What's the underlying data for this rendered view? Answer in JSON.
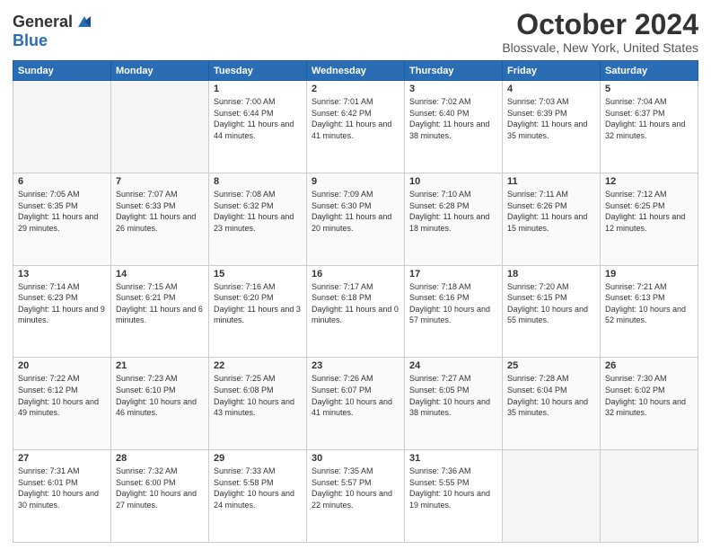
{
  "logo": {
    "general": "General",
    "blue": "Blue"
  },
  "header": {
    "month": "October 2024",
    "location": "Blossvale, New York, United States"
  },
  "weekdays": [
    "Sunday",
    "Monday",
    "Tuesday",
    "Wednesday",
    "Thursday",
    "Friday",
    "Saturday"
  ],
  "weeks": [
    [
      {
        "day": "",
        "empty": true
      },
      {
        "day": "",
        "empty": true
      },
      {
        "day": "1",
        "sunrise": "Sunrise: 7:00 AM",
        "sunset": "Sunset: 6:44 PM",
        "daylight": "Daylight: 11 hours and 44 minutes."
      },
      {
        "day": "2",
        "sunrise": "Sunrise: 7:01 AM",
        "sunset": "Sunset: 6:42 PM",
        "daylight": "Daylight: 11 hours and 41 minutes."
      },
      {
        "day": "3",
        "sunrise": "Sunrise: 7:02 AM",
        "sunset": "Sunset: 6:40 PM",
        "daylight": "Daylight: 11 hours and 38 minutes."
      },
      {
        "day": "4",
        "sunrise": "Sunrise: 7:03 AM",
        "sunset": "Sunset: 6:39 PM",
        "daylight": "Daylight: 11 hours and 35 minutes."
      },
      {
        "day": "5",
        "sunrise": "Sunrise: 7:04 AM",
        "sunset": "Sunset: 6:37 PM",
        "daylight": "Daylight: 11 hours and 32 minutes."
      }
    ],
    [
      {
        "day": "6",
        "sunrise": "Sunrise: 7:05 AM",
        "sunset": "Sunset: 6:35 PM",
        "daylight": "Daylight: 11 hours and 29 minutes."
      },
      {
        "day": "7",
        "sunrise": "Sunrise: 7:07 AM",
        "sunset": "Sunset: 6:33 PM",
        "daylight": "Daylight: 11 hours and 26 minutes."
      },
      {
        "day": "8",
        "sunrise": "Sunrise: 7:08 AM",
        "sunset": "Sunset: 6:32 PM",
        "daylight": "Daylight: 11 hours and 23 minutes."
      },
      {
        "day": "9",
        "sunrise": "Sunrise: 7:09 AM",
        "sunset": "Sunset: 6:30 PM",
        "daylight": "Daylight: 11 hours and 20 minutes."
      },
      {
        "day": "10",
        "sunrise": "Sunrise: 7:10 AM",
        "sunset": "Sunset: 6:28 PM",
        "daylight": "Daylight: 11 hours and 18 minutes."
      },
      {
        "day": "11",
        "sunrise": "Sunrise: 7:11 AM",
        "sunset": "Sunset: 6:26 PM",
        "daylight": "Daylight: 11 hours and 15 minutes."
      },
      {
        "day": "12",
        "sunrise": "Sunrise: 7:12 AM",
        "sunset": "Sunset: 6:25 PM",
        "daylight": "Daylight: 11 hours and 12 minutes."
      }
    ],
    [
      {
        "day": "13",
        "sunrise": "Sunrise: 7:14 AM",
        "sunset": "Sunset: 6:23 PM",
        "daylight": "Daylight: 11 hours and 9 minutes."
      },
      {
        "day": "14",
        "sunrise": "Sunrise: 7:15 AM",
        "sunset": "Sunset: 6:21 PM",
        "daylight": "Daylight: 11 hours and 6 minutes."
      },
      {
        "day": "15",
        "sunrise": "Sunrise: 7:16 AM",
        "sunset": "Sunset: 6:20 PM",
        "daylight": "Daylight: 11 hours and 3 minutes."
      },
      {
        "day": "16",
        "sunrise": "Sunrise: 7:17 AM",
        "sunset": "Sunset: 6:18 PM",
        "daylight": "Daylight: 11 hours and 0 minutes."
      },
      {
        "day": "17",
        "sunrise": "Sunrise: 7:18 AM",
        "sunset": "Sunset: 6:16 PM",
        "daylight": "Daylight: 10 hours and 57 minutes."
      },
      {
        "day": "18",
        "sunrise": "Sunrise: 7:20 AM",
        "sunset": "Sunset: 6:15 PM",
        "daylight": "Daylight: 10 hours and 55 minutes."
      },
      {
        "day": "19",
        "sunrise": "Sunrise: 7:21 AM",
        "sunset": "Sunset: 6:13 PM",
        "daylight": "Daylight: 10 hours and 52 minutes."
      }
    ],
    [
      {
        "day": "20",
        "sunrise": "Sunrise: 7:22 AM",
        "sunset": "Sunset: 6:12 PM",
        "daylight": "Daylight: 10 hours and 49 minutes."
      },
      {
        "day": "21",
        "sunrise": "Sunrise: 7:23 AM",
        "sunset": "Sunset: 6:10 PM",
        "daylight": "Daylight: 10 hours and 46 minutes."
      },
      {
        "day": "22",
        "sunrise": "Sunrise: 7:25 AM",
        "sunset": "Sunset: 6:08 PM",
        "daylight": "Daylight: 10 hours and 43 minutes."
      },
      {
        "day": "23",
        "sunrise": "Sunrise: 7:26 AM",
        "sunset": "Sunset: 6:07 PM",
        "daylight": "Daylight: 10 hours and 41 minutes."
      },
      {
        "day": "24",
        "sunrise": "Sunrise: 7:27 AM",
        "sunset": "Sunset: 6:05 PM",
        "daylight": "Daylight: 10 hours and 38 minutes."
      },
      {
        "day": "25",
        "sunrise": "Sunrise: 7:28 AM",
        "sunset": "Sunset: 6:04 PM",
        "daylight": "Daylight: 10 hours and 35 minutes."
      },
      {
        "day": "26",
        "sunrise": "Sunrise: 7:30 AM",
        "sunset": "Sunset: 6:02 PM",
        "daylight": "Daylight: 10 hours and 32 minutes."
      }
    ],
    [
      {
        "day": "27",
        "sunrise": "Sunrise: 7:31 AM",
        "sunset": "Sunset: 6:01 PM",
        "daylight": "Daylight: 10 hours and 30 minutes."
      },
      {
        "day": "28",
        "sunrise": "Sunrise: 7:32 AM",
        "sunset": "Sunset: 6:00 PM",
        "daylight": "Daylight: 10 hours and 27 minutes."
      },
      {
        "day": "29",
        "sunrise": "Sunrise: 7:33 AM",
        "sunset": "Sunset: 5:58 PM",
        "daylight": "Daylight: 10 hours and 24 minutes."
      },
      {
        "day": "30",
        "sunrise": "Sunrise: 7:35 AM",
        "sunset": "Sunset: 5:57 PM",
        "daylight": "Daylight: 10 hours and 22 minutes."
      },
      {
        "day": "31",
        "sunrise": "Sunrise: 7:36 AM",
        "sunset": "Sunset: 5:55 PM",
        "daylight": "Daylight: 10 hours and 19 minutes."
      },
      {
        "day": "",
        "empty": true
      },
      {
        "day": "",
        "empty": true
      }
    ]
  ]
}
